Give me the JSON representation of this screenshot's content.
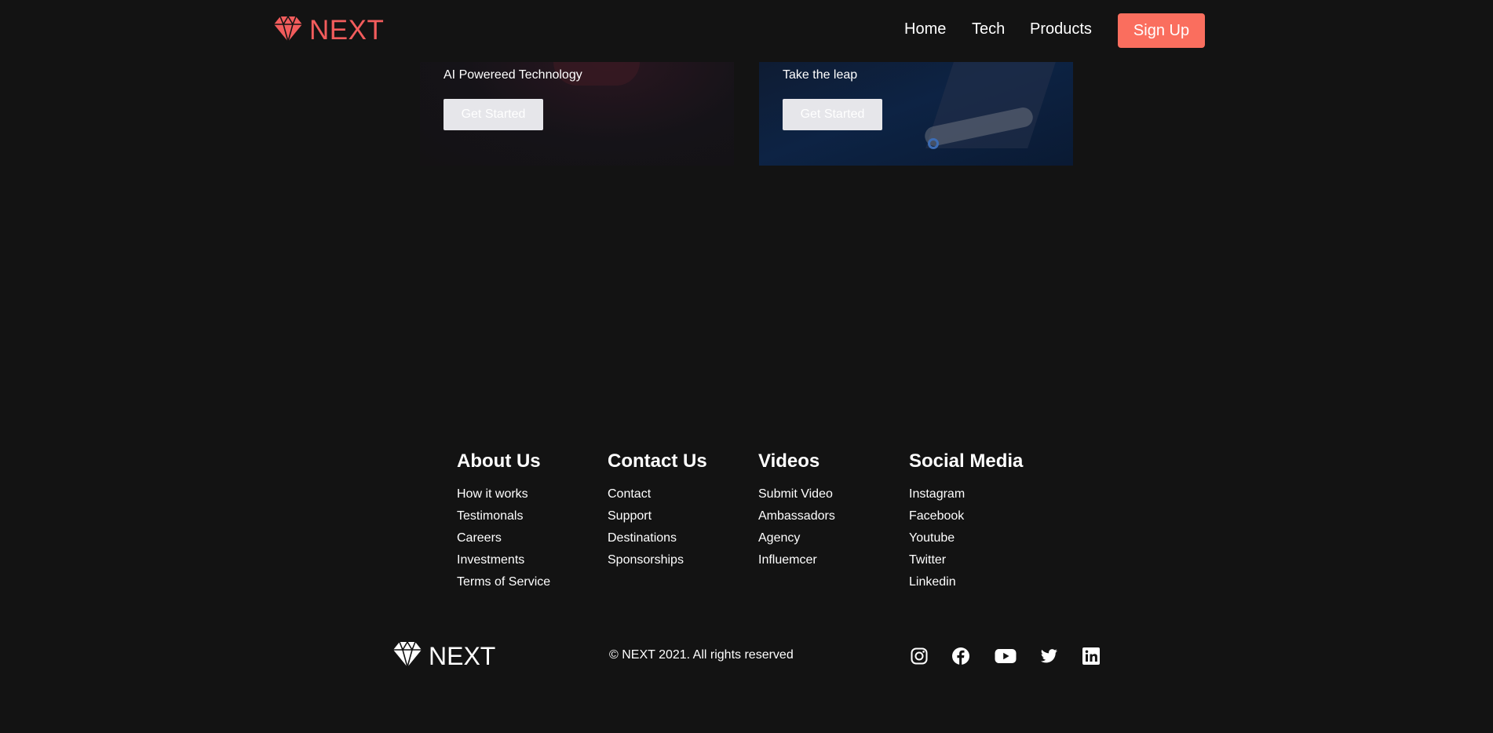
{
  "brand": {
    "name": "NEXT",
    "accent": "#f25c5c"
  },
  "nav": {
    "links": [
      "Home",
      "Tech",
      "Products"
    ],
    "signup_label": "Sign Up",
    "signup_color": "#fa6e5e"
  },
  "cards": [
    {
      "description": "AI Powereed Technology",
      "button_label": "Get Started"
    },
    {
      "description": "Take the leap",
      "button_label": "Get Started"
    }
  ],
  "footer": {
    "columns": [
      {
        "title": "About Us",
        "links": [
          "How it works",
          "Testimonals",
          "Careers",
          "Investments",
          "Terms of Service"
        ]
      },
      {
        "title": "Contact Us",
        "links": [
          "Contact",
          "Support",
          "Destinations",
          "Sponsorships"
        ]
      },
      {
        "title": "Videos",
        "links": [
          "Submit Video",
          "Ambassadors",
          "Agency",
          "Influemcer"
        ]
      },
      {
        "title": "Social Media",
        "links": [
          "Instagram",
          "Facebook",
          "Youtube",
          "Twitter",
          "Linkedin"
        ]
      }
    ],
    "copyright": "© NEXT 2021. All rights reserved",
    "social_icons": [
      "instagram-icon",
      "facebook-icon",
      "youtube-icon",
      "twitter-icon",
      "linkedin-icon"
    ]
  }
}
